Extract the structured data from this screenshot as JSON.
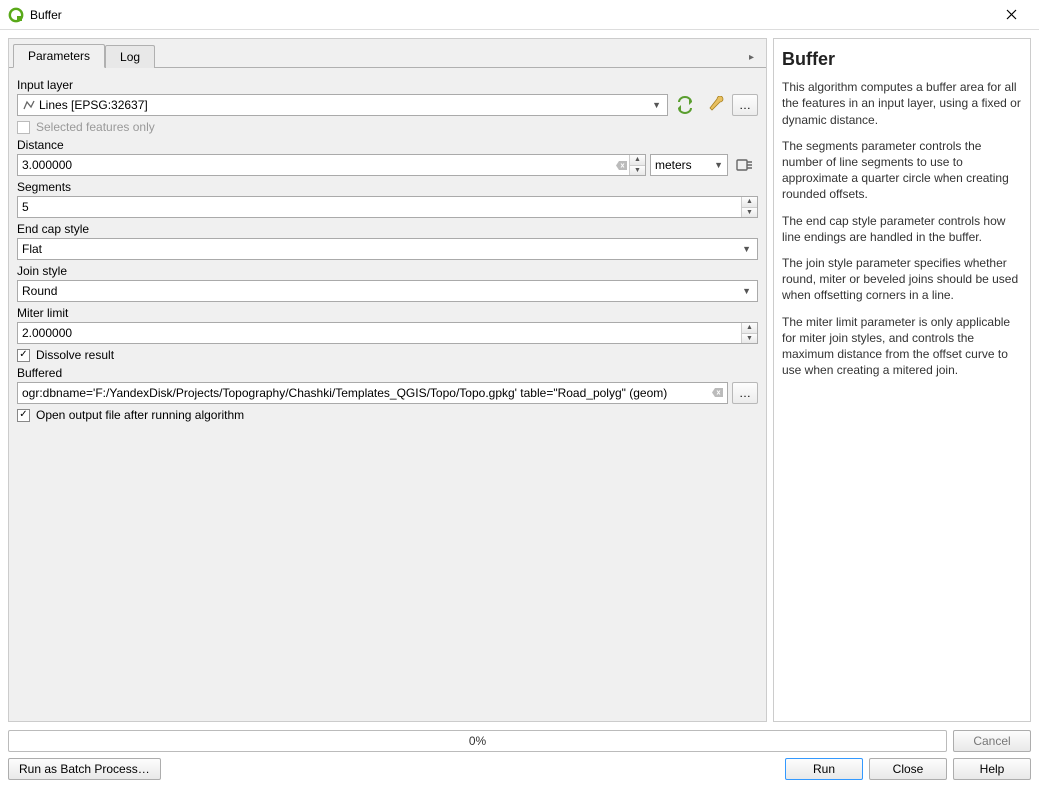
{
  "window": {
    "title": "Buffer"
  },
  "tabs": {
    "parameters": "Parameters",
    "log": "Log"
  },
  "labels": {
    "input_layer": "Input layer",
    "selected_only": "Selected features only",
    "distance": "Distance",
    "segments": "Segments",
    "end_cap": "End cap style",
    "join_style": "Join style",
    "miter_limit": "Miter limit",
    "dissolve": "Dissolve result",
    "buffered": "Buffered",
    "open_output": "Open output file after running algorithm"
  },
  "values": {
    "input_layer": "Lines [EPSG:32637]",
    "distance": "3.000000",
    "units": "meters",
    "segments": "5",
    "end_cap": "Flat",
    "join_style": "Round",
    "miter_limit": "2.000000",
    "buffered_output": "ogr:dbname='F:/YandexDisk/Projects/Topography/Chashki/Templates_QGIS/Topo/Topo.gpkg' table=\"Road_polyg\" (geom)",
    "dissolve_checked": true,
    "open_output_checked": true,
    "selected_only_checked": false
  },
  "progress": {
    "text": "0%"
  },
  "buttons": {
    "cancel": "Cancel",
    "batch": "Run as Batch Process…",
    "run": "Run",
    "close": "Close",
    "help": "Help"
  },
  "help": {
    "title": "Buffer",
    "p1": "This algorithm computes a buffer area for all the features in an input layer, using a fixed or dynamic distance.",
    "p2": "The segments parameter controls the number of line segments to use to approximate a quarter circle when creating rounded offsets.",
    "p3": "The end cap style parameter controls how line endings are handled in the buffer.",
    "p4": "The join style parameter specifies whether round, miter or beveled joins should be used when offsetting corners in a line.",
    "p5": "The miter limit parameter is only applicable for miter join styles, and controls the maximum distance from the offset curve to use when creating a mitered join."
  }
}
